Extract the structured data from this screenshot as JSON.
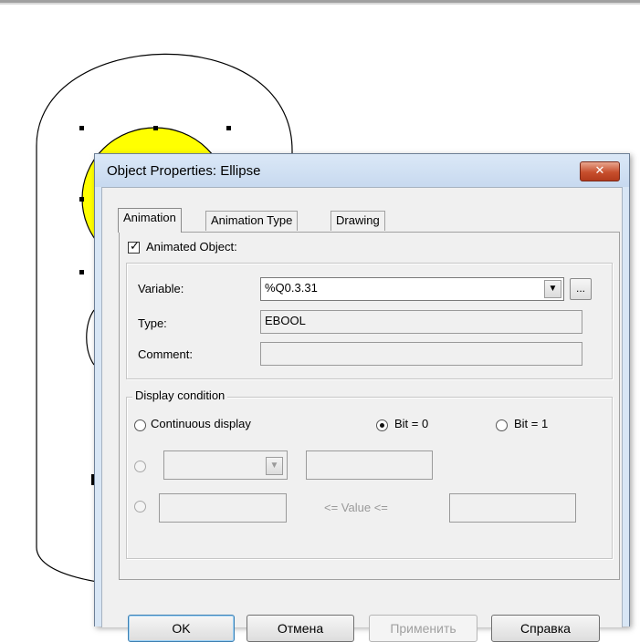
{
  "dialog": {
    "title": "Object Properties: Ellipse",
    "close_glyph": "✕",
    "tabs": [
      {
        "label": "Animation",
        "active": true
      },
      {
        "label": "Animation Type",
        "active": false
      },
      {
        "label": "Drawing",
        "active": false
      }
    ],
    "animated_object": {
      "label": "Animated Object:",
      "checked": true
    },
    "variable": {
      "label": "Variable:",
      "value": "%Q0.3.31",
      "browse_label": "..."
    },
    "type": {
      "label": "Type:",
      "value": "EBOOL"
    },
    "comment": {
      "label": "Comment:",
      "value": ""
    },
    "display_condition": {
      "caption": "Display condition",
      "continuous_label": "Continuous display",
      "bit0_label": "Bit = 0",
      "bit1_label": "Bit = 1",
      "selected": "bit0",
      "range_label": "<= Value <="
    },
    "buttons": {
      "ok": "OK",
      "cancel": "Отмена",
      "apply": "Применить",
      "help": "Справка"
    }
  },
  "colors": {
    "ellipse_fill": "#ffff00",
    "close_button": "#c74f2d",
    "title_bar": "#d8e6f5"
  }
}
